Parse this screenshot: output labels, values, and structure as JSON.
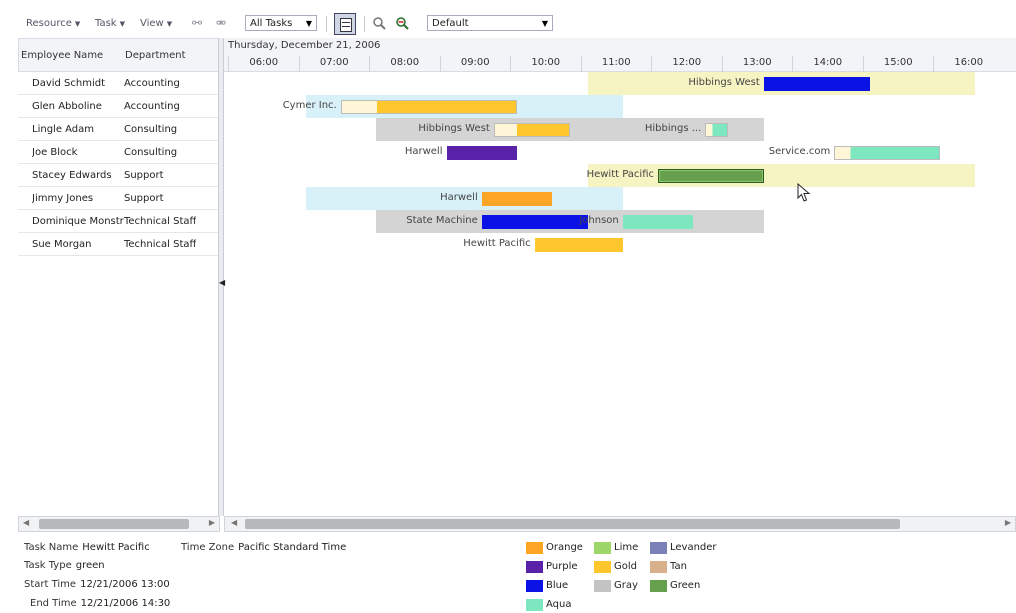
{
  "toolbar": {
    "menus": [
      "Resource",
      "Task",
      "View"
    ],
    "filter_value": "All Tasks",
    "scheme_value": "Default"
  },
  "left_table": {
    "headers": [
      "Employee Name",
      "Department"
    ],
    "rows": [
      {
        "name": "David Schmidt",
        "department": "Accounting"
      },
      {
        "name": "Glen Abboline",
        "department": "Accounting"
      },
      {
        "name": "Lingle Adam",
        "department": "Consulting"
      },
      {
        "name": "Joe Block",
        "department": "Consulting"
      },
      {
        "name": "Stacey Edwards",
        "department": "Support"
      },
      {
        "name": "Jimmy Jones",
        "department": "Support"
      },
      {
        "name": "Dominique Monstr",
        "department": "Technical Staff"
      },
      {
        "name": "Sue Morgan",
        "department": "Technical Staff"
      }
    ]
  },
  "gantt": {
    "date": "Thursday, December 21, 2006",
    "hours": [
      "06:00",
      "07:00",
      "08:00",
      "09:00",
      "10:00",
      "11:00",
      "12:00",
      "13:00",
      "14:00",
      "15:00",
      "16:00"
    ],
    "rows": [
      {
        "band": {
          "start": 11.0,
          "end": 16.5,
          "color": "#f7f4c4"
        },
        "tasks": [
          {
            "label": "Hibbings West",
            "start": 13.5,
            "end": 15.0,
            "color": "#0a12e6"
          }
        ]
      },
      {
        "band": {
          "start": 7.0,
          "end": 11.5,
          "color": "#d8f1f8"
        },
        "tasks": [
          {
            "label": "Cymer Inc.",
            "start": 7.5,
            "end": 10.0,
            "color": "#ffc62e",
            "fade": 0.2
          }
        ]
      },
      {
        "band": {
          "start": 8.0,
          "end": 13.5,
          "color": "#d4d4d4"
        },
        "tasks": [
          {
            "label": "Hibbings West",
            "start": 9.67,
            "end": 10.75,
            "color": "#ffc62e",
            "fade": 0.3
          },
          {
            "label": "Hibbings ...",
            "start": 12.67,
            "end": 13.0,
            "color": "#7de8c0",
            "fade": 0.3
          }
        ]
      },
      {
        "band": null,
        "tasks": [
          {
            "label": "Harwell",
            "start": 9.0,
            "end": 10.0,
            "color": "#5a22a8"
          },
          {
            "label": "Service.com",
            "start": 14.5,
            "end": 16.0,
            "color": "#7de8c0",
            "fade": 0.15
          }
        ]
      },
      {
        "band": {
          "start": 11.0,
          "end": 16.5,
          "color": "#f7f4c4"
        },
        "tasks": [
          {
            "label": "Hewitt Pacific",
            "start": 12.0,
            "end": 13.5,
            "color": "#66a04c",
            "selected": true
          }
        ]
      },
      {
        "band": {
          "start": 7.0,
          "end": 11.5,
          "color": "#d8f1f8"
        },
        "tasks": [
          {
            "label": "Harwell",
            "start": 9.5,
            "end": 10.5,
            "color": "#ffa526"
          }
        ]
      },
      {
        "band": {
          "start": 8.0,
          "end": 13.5,
          "color": "#d4d4d4"
        },
        "tasks": [
          {
            "label": "State Machine",
            "start": 9.5,
            "end": 11.0,
            "color": "#0a12e6"
          },
          {
            "label": "Johnson",
            "start": 11.5,
            "end": 12.5,
            "color": "#7de8c0"
          }
        ]
      },
      {
        "band": null,
        "tasks": [
          {
            "label": "Hewitt Pacific",
            "start": 10.25,
            "end": 11.5,
            "color": "#ffc62e"
          }
        ]
      }
    ]
  },
  "details": {
    "task_name_label": "Task Name",
    "task_name": "Hewitt Pacific",
    "time_zone_label": "Time Zone",
    "time_zone": "Pacific Standard Time",
    "task_type_label": "Task Type",
    "task_type": "green",
    "start_time_label": "Start Time",
    "start_time": "12/21/2006 13:00",
    "end_time_label": "End Time",
    "end_time": "12/21/2006 14:30"
  },
  "legend": [
    {
      "label": "Orange",
      "color": "#ffa526"
    },
    {
      "label": "Lime",
      "color": "#9ed66a"
    },
    {
      "label": "Levander",
      "color": "#7c80b8"
    },
    {
      "label": "Purple",
      "color": "#5a22a8"
    },
    {
      "label": "Gold",
      "color": "#ffc62e"
    },
    {
      "label": "Tan",
      "color": "#d8b08c"
    },
    {
      "label": "Blue",
      "color": "#0a12e6"
    },
    {
      "label": "Gray",
      "color": "#c4c4c4"
    },
    {
      "label": "Green",
      "color": "#66a04c"
    },
    {
      "label": "Aqua",
      "color": "#7de8c0"
    }
  ]
}
